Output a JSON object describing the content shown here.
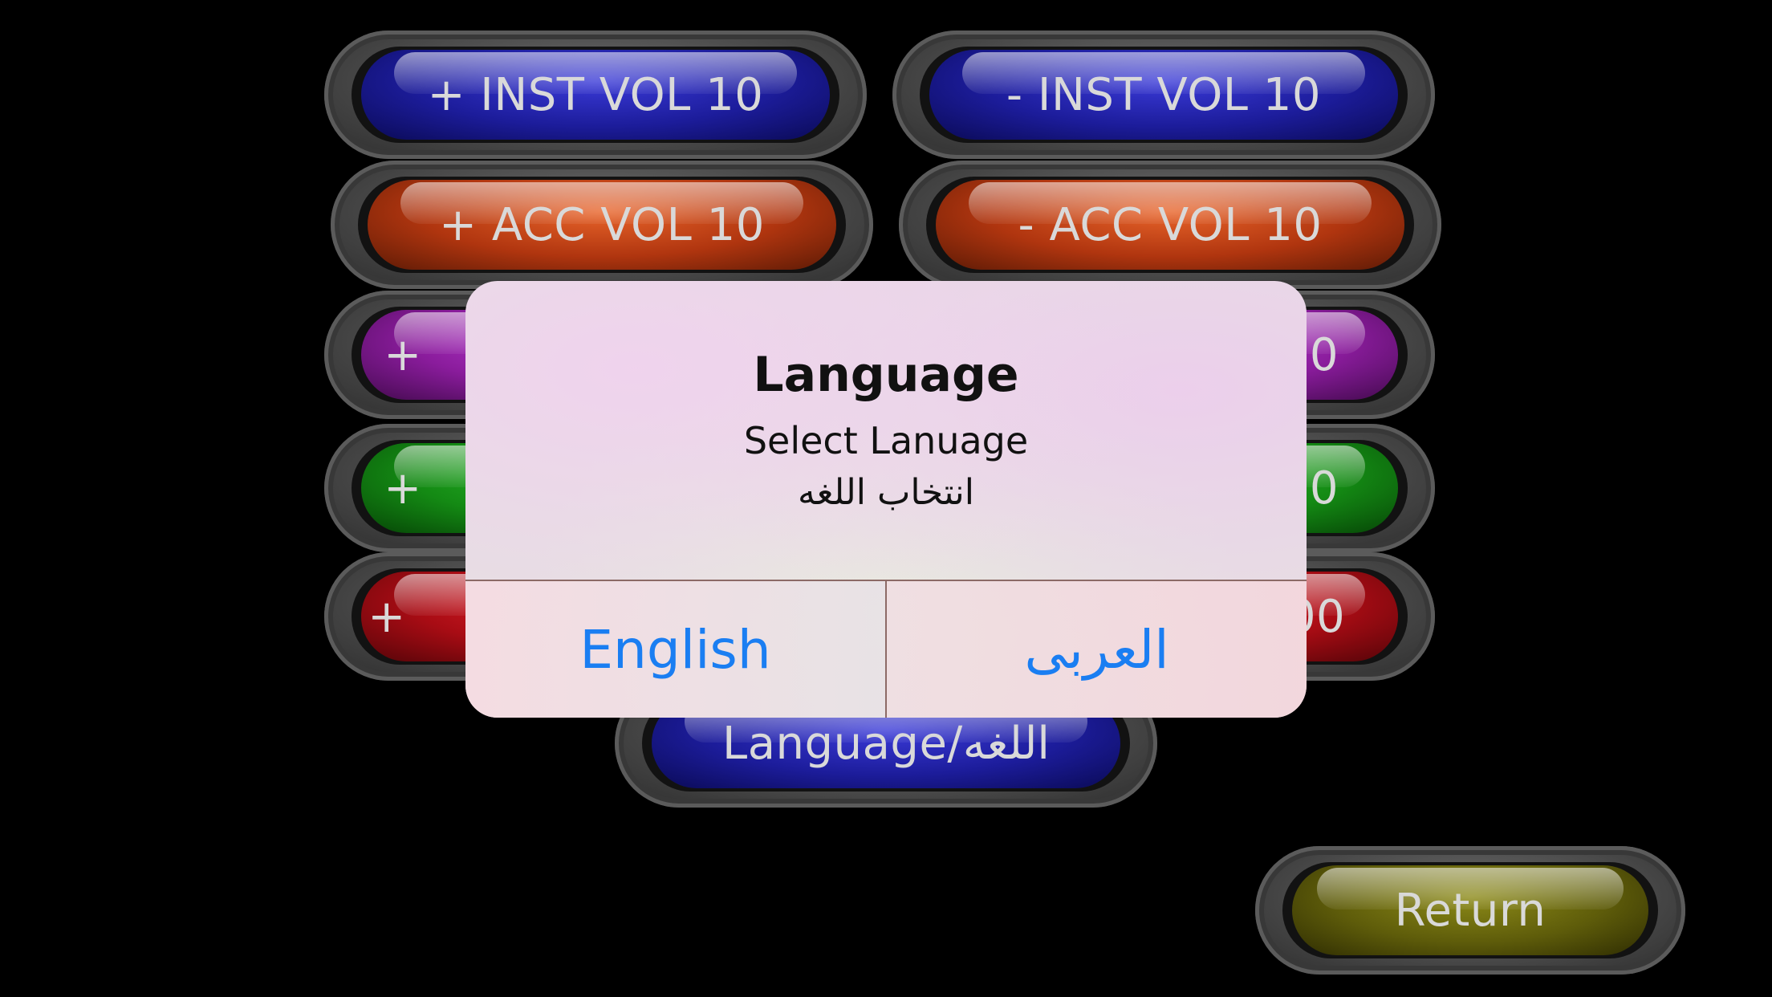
{
  "buttons": {
    "inst_vol_up": "+ INST VOL 10",
    "inst_vol_down": "- INST VOL 10",
    "acc_vol_up": "+ ACC VOL 10",
    "acc_vol_down": "- ACC VOL 10",
    "purple_left_visible": "+",
    "purple_right_visible": "0",
    "green_left_visible": "+",
    "green_right_visible": "0",
    "red_left_visible": "+",
    "red_right_visible": "00",
    "language": "Language/اللغه",
    "return": "Return"
  },
  "alert": {
    "title": "Language",
    "message_en": "Select Lanuage",
    "message_ar": "انتخاب اللغه",
    "english_label": "English",
    "arabic_label": "العربى"
  },
  "colors": {
    "background": "#000000",
    "blue": "#1c1c9a",
    "orange": "#b0350f",
    "purple": "#8a1c9c",
    "green": "#148a14",
    "red": "#a80c14",
    "olive": "#5e5c0a",
    "alert_action": "#1a7ef2"
  }
}
